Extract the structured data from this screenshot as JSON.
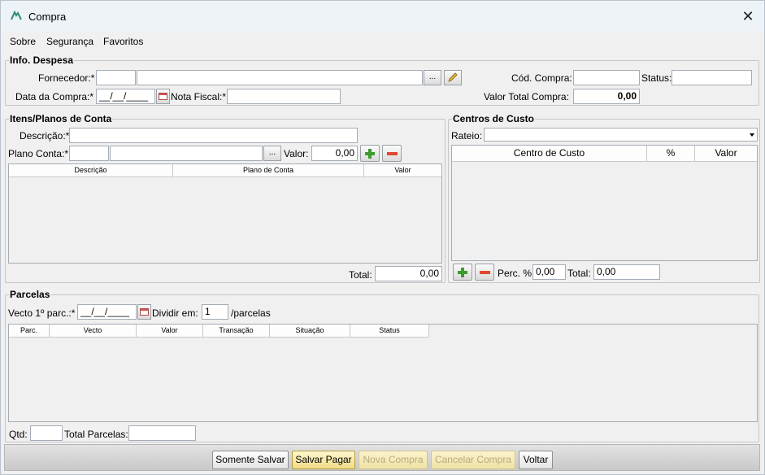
{
  "window": {
    "title": "Compra",
    "close": "✕"
  },
  "menu": [
    "Sobre",
    "Segurança",
    "Favoritos"
  ],
  "info": {
    "group_title": "Info. Despesa",
    "fornecedor_label": "Fornecedor:*",
    "fornecedor_code": "",
    "fornecedor_name": "",
    "browse": "...",
    "data_compra_label": "Data da Compra:*",
    "data_compra_value": "__/__/____",
    "nota_fiscal_label": "Nota Fiscal:*",
    "nota_fiscal_value": "",
    "cod_compra_label": "Cód. Compra:",
    "cod_compra_value": "",
    "status_label": "Status:",
    "status_value": "",
    "valor_total_label": "Valor Total Compra:",
    "valor_total_value": "0,00"
  },
  "itens": {
    "group_title": "Itens/Planos de Conta",
    "descricao_label": "Descrição:*",
    "descricao_value": "",
    "plano_label": "Plano Conta:*",
    "plano_code": "",
    "plano_name": "",
    "browse": "...",
    "valor_label": "Valor:",
    "valor_value": "0,00",
    "columns": [
      "Descrição",
      "Plano de Conta",
      "Valor"
    ],
    "total_label": "Total:",
    "total_value": "0,00"
  },
  "centros": {
    "group_title": "Centros de Custo",
    "rateio_label": "Rateio:",
    "rateio_value": "",
    "columns": [
      "Centro de Custo",
      "%",
      "Valor"
    ],
    "perc_label": "Perc. %:",
    "perc_value": "0,00",
    "total_label": "Total:",
    "total_value": "0,00"
  },
  "parcelas": {
    "group_title": "Parcelas",
    "vecto_label": "Vecto 1º parc.:*",
    "vecto_value": "__/__/____",
    "dividir_label": "Dividir em:",
    "dividir_value": "1",
    "parcelas_suffix": "/parcelas",
    "columns": [
      "Parc.",
      "Vecto",
      "Valor",
      "Transação",
      "Situação",
      "Status"
    ],
    "qtd_label": "Qtd:",
    "qtd_value": "",
    "total_label": "Total Parcelas:",
    "total_value": ""
  },
  "footer": {
    "somente_salvar": "Somente Salvar",
    "salvar_pagar": "Salvar Pagar",
    "nova_compra": "Nova Compra",
    "cancelar_compra": "Cancelar Compra",
    "voltar": "Voltar"
  },
  "colors": {
    "accent_green": "#3c9b2d",
    "accent_red": "#e0482f",
    "primary_button": "#f1db86",
    "logo": "#2e8b7a"
  }
}
